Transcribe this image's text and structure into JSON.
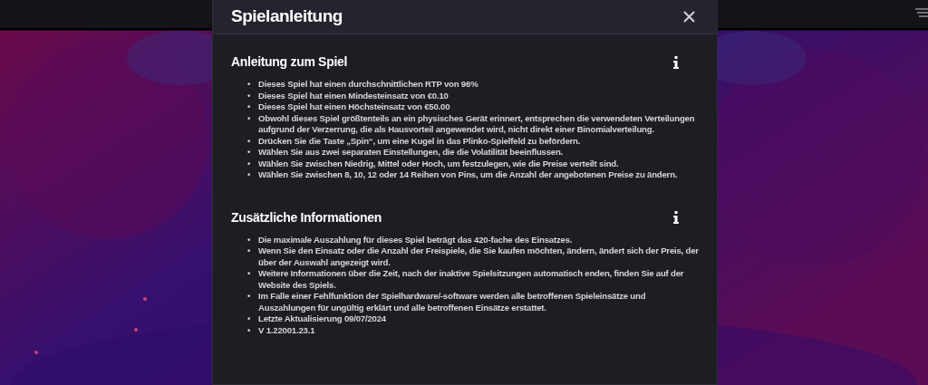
{
  "dialog": {
    "title": "Spielanleitung",
    "sections": [
      {
        "title": "Anleitung zum Spiel",
        "bullet": "•",
        "items": [
          "Dieses Spiel hat einen durchschnittlichen RTP von 96%",
          "Dieses Spiel hat einen Mindesteinsatz von €0.10",
          "Dieses Spiel hat einen Höchsteinsatz von €50.00",
          "Obwohl dieses Spiel größtenteils an ein physisches Gerät erinnert, entsprechen die verwendeten Verteilungen aufgrund der Verzerrung, die als Hausvorteil angewendet wird, nicht direkt einer Binomialverteilung.",
          "Drücken Sie die Taste „Spin“, um eine Kugel in das Plinko-Spielfeld zu befördern.",
          "Wählen Sie aus zwei separaten Einstellungen, die die Volatilität beeinflussen.",
          "Wählen Sie zwischen Niedrig, Mittel oder Hoch, um festzulegen, wie die Preise verteilt sind.",
          "Wählen Sie zwischen 8, 10, 12 oder 14 Reihen von Pins, um die Anzahl der angebotenen Preise zu ändern."
        ]
      },
      {
        "title": "Zusätzliche Informationen",
        "bullet": "•",
        "items": [
          "Die maximale Auszahlung für dieses Spiel beträgt das 420-fache des Einsatzes.",
          "Wenn Sie den Einsatz oder die Anzahl der Freispiele, die Sie kaufen möchten, ändern, ändert sich der Preis, der über der Auswahl angezeigt wird.",
          "Weitere Informationen über die Zeit, nach der inaktive Spielsitzungen automatisch enden, finden Sie auf der Website des Spiels.",
          "Im Falle einer Fehlfunktion der Spielhardware/-software werden alle betroffenen Spieleinsätze und Auszahlungen für ungültig erklärt und alle betroffenen Einsätze erstattet.",
          "Letzte Aktualisierung 09/07/2024",
          "V 1.22001.23.1"
        ]
      }
    ]
  }
}
